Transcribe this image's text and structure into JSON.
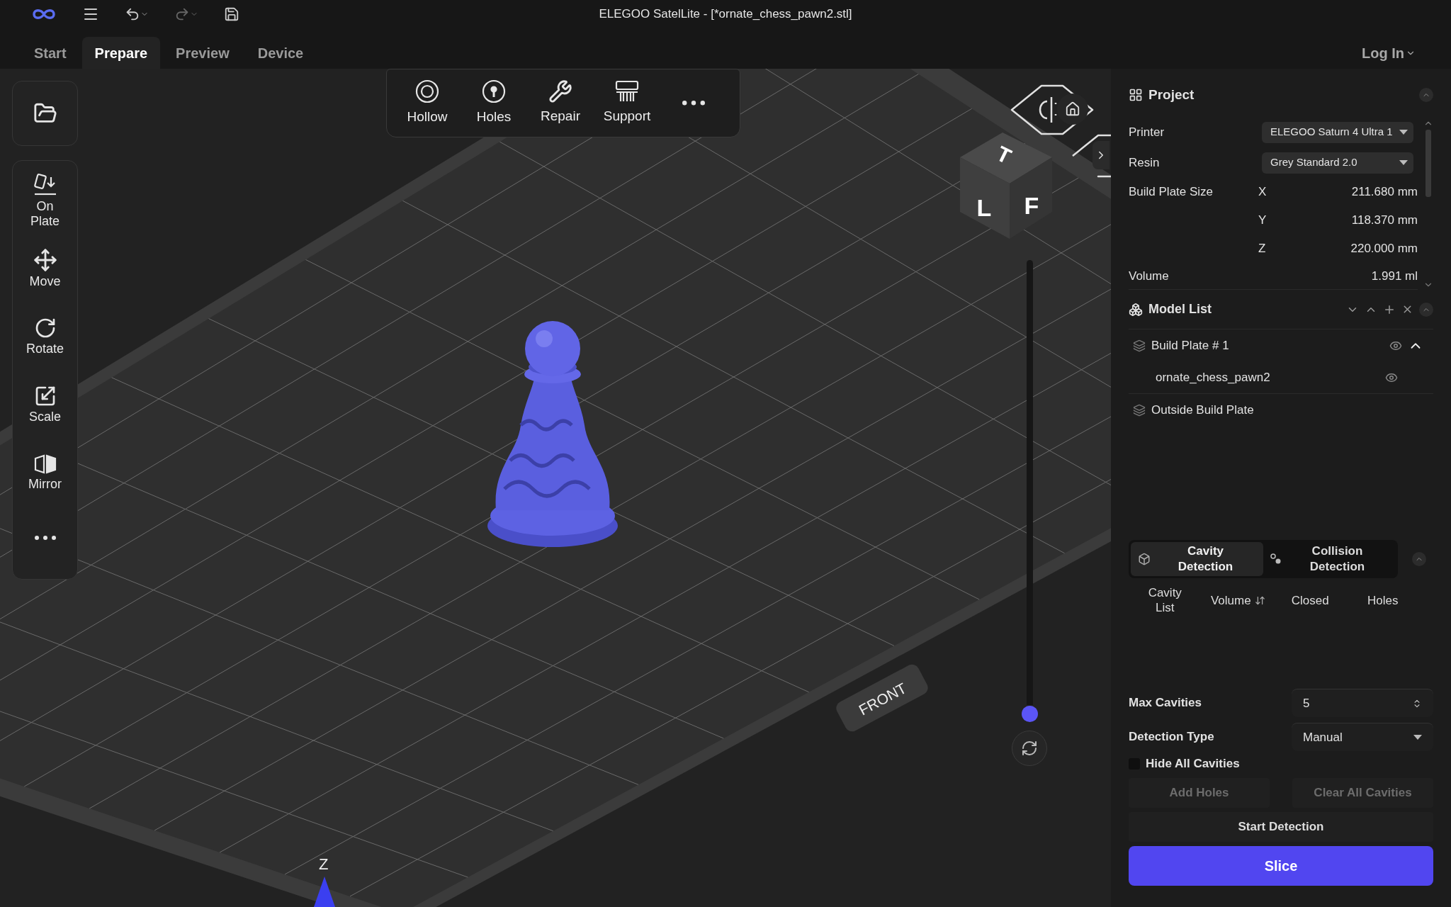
{
  "window": {
    "title": "ELEGOO SatelLite - [*ornate_chess_pawn2.stl]"
  },
  "tabs": [
    {
      "label": "Start",
      "selected": false
    },
    {
      "label": "Prepare",
      "selected": true
    },
    {
      "label": "Preview",
      "selected": false
    },
    {
      "label": "Device",
      "selected": false
    }
  ],
  "account": {
    "label": "Log In"
  },
  "top_toolbar": [
    {
      "label": "Hollow",
      "kind": "hollow"
    },
    {
      "label": "Holes",
      "kind": "holes"
    },
    {
      "label": "Repair",
      "kind": "repair"
    },
    {
      "label": "Support",
      "kind": "support"
    },
    {
      "kind": "more"
    }
  ],
  "left_toolbar": [
    {
      "label": "On Plate",
      "kind": "on_plate"
    },
    {
      "label": "Move",
      "kind": "move"
    },
    {
      "label": "Rotate",
      "kind": "rotate"
    },
    {
      "label": "Scale",
      "kind": "scale"
    },
    {
      "label": "Mirror",
      "kind": "mirror"
    },
    {
      "kind": "more"
    }
  ],
  "viewport": {
    "view_cube": {
      "top": "T",
      "left": "L",
      "front": "F"
    },
    "plate_label": "FRONT",
    "axis_label": "Z",
    "layer_slider": {
      "level": 0
    }
  },
  "project": {
    "title": "Project",
    "fields": [
      {
        "label": "Printer",
        "value": "ELEGOO Saturn 4 Ultra 1"
      },
      {
        "label": "Resin",
        "value": "Grey Standard 2.0"
      }
    ],
    "build_plate_size": {
      "label": "Build Plate Size",
      "axes": [
        {
          "axis": "X",
          "value": "211.680 mm"
        },
        {
          "axis": "Y",
          "value": "118.370 mm"
        },
        {
          "axis": "Z",
          "value": "220.000 mm"
        }
      ]
    },
    "volume": {
      "label": "Volume",
      "value": "1.991 ml"
    }
  },
  "model_list": {
    "title": "Model List",
    "groups": [
      {
        "name": "Build Plate # 1",
        "expanded": true,
        "visible": true,
        "children": [
          {
            "name": "ornate_chess_pawn2",
            "visible": true
          }
        ]
      },
      {
        "name": "Outside Build Plate"
      }
    ]
  },
  "detection": {
    "tabs": [
      {
        "label": "Cavity Detection",
        "kind": "cavity",
        "selected": true
      },
      {
        "label": "Collision Detection",
        "kind": "collision",
        "selected": false
      }
    ],
    "columns": [
      {
        "label": "Cavity List"
      },
      {
        "label": "Volume",
        "sortable": true
      },
      {
        "label": "Closed"
      },
      {
        "label": "Holes"
      }
    ],
    "max_cavities": {
      "label": "Max Cavities",
      "value": "5"
    },
    "detection_type": {
      "label": "Detection Type",
      "value": "Manual"
    },
    "hide_all": {
      "label": "Hide All Cavities",
      "checked": false
    },
    "buttons": [
      {
        "label": "Add Holes",
        "disabled": true
      },
      {
        "label": "Clear All Cavities",
        "disabled": true
      }
    ],
    "start": {
      "label": "Start Detection"
    },
    "slice": {
      "label": "Slice"
    }
  }
}
